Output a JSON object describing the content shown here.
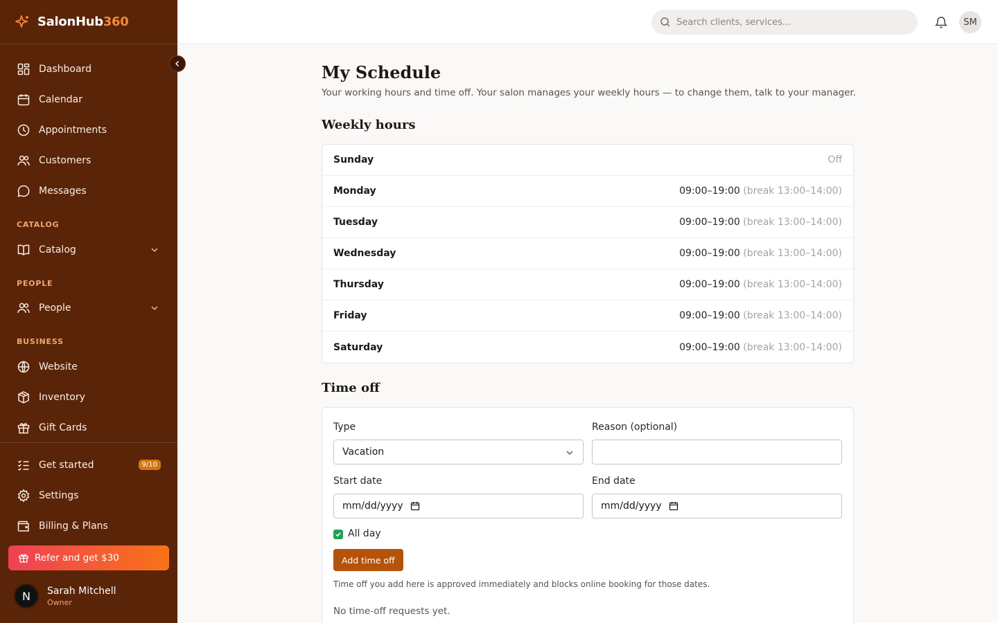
{
  "brand": {
    "name": "SalonHub",
    "accent": "360"
  },
  "sidebar": {
    "nav": [
      {
        "label": "Dashboard",
        "icon": "dashboard-icon"
      },
      {
        "label": "Calendar",
        "icon": "calendar-icon"
      },
      {
        "label": "Appointments",
        "icon": "clock-icon"
      },
      {
        "label": "Customers",
        "icon": "users-icon"
      },
      {
        "label": "Messages",
        "icon": "message-icon"
      }
    ],
    "sections": {
      "catalog": {
        "heading": "CATALOG",
        "item": "Catalog"
      },
      "people": {
        "heading": "PEOPLE",
        "item": "People"
      },
      "business": {
        "heading": "BUSINESS",
        "items": [
          "Website",
          "Inventory",
          "Gift Cards"
        ]
      }
    },
    "bottom": [
      {
        "label": "Get started",
        "badge": "9/10"
      },
      {
        "label": "Settings"
      },
      {
        "label": "Billing & Plans"
      }
    ],
    "refer": "Refer and get $30",
    "user": {
      "initial": "N",
      "name": "Sarah Mitchell",
      "role": "Owner"
    }
  },
  "header": {
    "search_placeholder": "Search clients, services...",
    "avatar_initials": "SM"
  },
  "page": {
    "title": "My Schedule",
    "subtitle": "Your working hours and time off. Your salon manages your weekly hours — to change them, talk to your manager."
  },
  "weekly": {
    "title": "Weekly hours",
    "days": [
      {
        "day": "Sunday",
        "off": "Off"
      },
      {
        "day": "Monday",
        "hours": "09:00–19:00",
        "break": "(break 13:00–14:00)"
      },
      {
        "day": "Tuesday",
        "hours": "09:00–19:00",
        "break": "(break 13:00–14:00)"
      },
      {
        "day": "Wednesday",
        "hours": "09:00–19:00",
        "break": "(break 13:00–14:00)"
      },
      {
        "day": "Thursday",
        "hours": "09:00–19:00",
        "break": "(break 13:00–14:00)"
      },
      {
        "day": "Friday",
        "hours": "09:00–19:00",
        "break": "(break 13:00–14:00)"
      },
      {
        "day": "Saturday",
        "hours": "09:00–19:00",
        "break": "(break 13:00–14:00)"
      }
    ]
  },
  "timeoff": {
    "title": "Time off",
    "type_label": "Type",
    "type_value": "Vacation",
    "reason_label": "Reason (optional)",
    "reason_value": "",
    "start_label": "Start date",
    "start_value": "mm/dd/yyyy",
    "end_label": "End date",
    "end_value": "mm/dd/yyyy",
    "all_day_label": "All day",
    "all_day_checked": true,
    "add_button": "Add time off",
    "note": "Time off you add here is approved immediately and blocks online booking for those dates.",
    "empty": "No time-off requests yet."
  },
  "colors": {
    "sidebar": "#5a2408",
    "accent": "#f38a3c",
    "button": "#b45309",
    "check": "#22a05a"
  }
}
